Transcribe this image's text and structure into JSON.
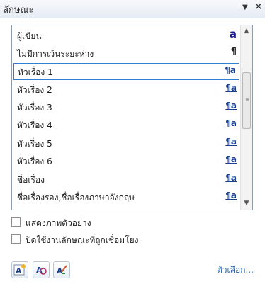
{
  "pane": {
    "title": "ลักษณะ",
    "menu_glyph": "▼",
    "close_glyph": "✕"
  },
  "styles": [
    {
      "label": "ผู้เขียน",
      "type_glyph": "a",
      "type": "character"
    },
    {
      "label": "ไม่มีการเว้นระยะห่าง",
      "type_glyph": "¶",
      "type": "paragraph"
    },
    {
      "label": "หัวเรื่อง 1",
      "type_glyph": "¶a",
      "type": "linked",
      "selected": true
    },
    {
      "label": "หัวเรื่อง 2",
      "type_glyph": "¶a",
      "type": "linked"
    },
    {
      "label": "หัวเรื่อง 3",
      "type_glyph": "¶a",
      "type": "linked"
    },
    {
      "label": "หัวเรื่อง 4",
      "type_glyph": "¶a",
      "type": "linked"
    },
    {
      "label": "หัวเรื่อง 5",
      "type_glyph": "¶a",
      "type": "linked"
    },
    {
      "label": "หัวเรื่อง 6",
      "type_glyph": "¶a",
      "type": "linked"
    },
    {
      "label": "ชื่อเรื่อง",
      "type_glyph": "¶a",
      "type": "linked"
    },
    {
      "label": "ชื่อเรื่องรอง,ชื่อเรื่องภาษาอังกฤษ",
      "type_glyph": "¶a",
      "type": "linked"
    }
  ],
  "checkboxes": {
    "show_preview": "แสดงภาพตัวอย่าง",
    "disable_linked": "ปิดใช้งานลักษณะที่ถูกเชื่อมโยง"
  },
  "footer": {
    "options_link": "ตัวเลือก...",
    "buttons": [
      "new-style-icon",
      "style-inspector-icon",
      "manage-styles-icon"
    ]
  },
  "colors": {
    "accent": "#2d7fd2",
    "link": "#1f5fad",
    "icon_blue": "#1a3f8f"
  }
}
